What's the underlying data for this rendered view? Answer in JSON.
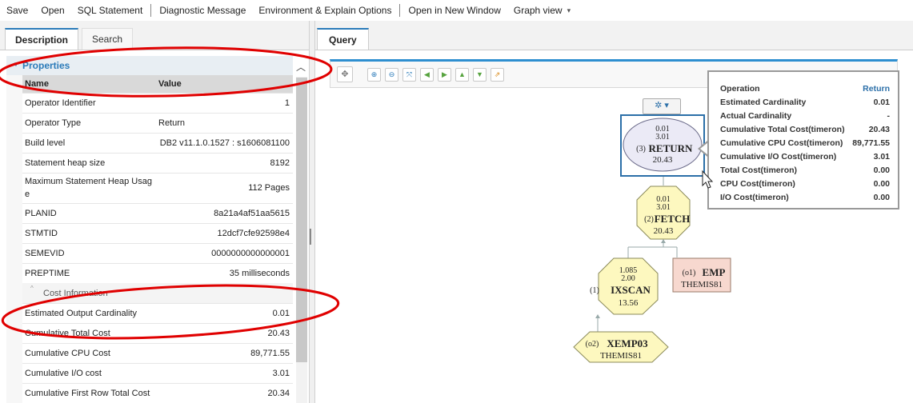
{
  "toolbar": {
    "save": "Save",
    "open": "Open",
    "sql_statement": "SQL Statement",
    "diagnostic": "Diagnostic Message",
    "environment": "Environment & Explain Options",
    "open_window": "Open in New Window",
    "graph_view": "Graph view",
    "graph_view_caret": "▾"
  },
  "left_tabs": {
    "description": "Description",
    "search": "Search"
  },
  "properties": {
    "title": "Properties",
    "header": {
      "name": "Name",
      "value": "Value"
    },
    "rows": [
      {
        "name": "Operator Identifier",
        "value": "1"
      },
      {
        "name": "Operator Type",
        "value": "Return"
      },
      {
        "name": "Build level",
        "value": "DB2 v11.1.0.1527 : s1606081100"
      },
      {
        "name": "Statement heap size",
        "value": "8192"
      },
      {
        "name": "Maximum Statement Heap Usag",
        "name2": "e",
        "value": "112 Pages"
      },
      {
        "name": "PLANID",
        "value": "8a21a4af51aa5615"
      },
      {
        "name": "STMTID",
        "value": "12dcf7cfe92598e4"
      },
      {
        "name": "SEMEVID",
        "value": "0000000000000001"
      },
      {
        "name": "PREPTIME",
        "value": "35 milliseconds"
      }
    ],
    "cost_section": "Cost Information",
    "cost_rows": [
      {
        "name": "Estimated Output Cardinality",
        "value": "0.01"
      },
      {
        "name": "Cumulative Total Cost",
        "value": "20.43"
      },
      {
        "name": "Cumulative CPU Cost",
        "value": "89,771.55"
      },
      {
        "name": "Cumulative I/O cost",
        "value": "3.01"
      },
      {
        "name": "Cumulative First Row Total Cost",
        "value": "20.34"
      }
    ]
  },
  "right_tab": "Query",
  "graph": {
    "return": {
      "card": "0.01",
      "io": "3.01",
      "id": "(3)",
      "label": "RETURN",
      "cost": "20.43"
    },
    "fetch": {
      "card": "0.01",
      "io": "3.01",
      "id": "(2)",
      "label": "FETCH",
      "cost": "20.43"
    },
    "ixscan": {
      "card": "1.085",
      "io": "2.00",
      "id": "(1)",
      "label": "IXSCAN",
      "cost": "13.56"
    },
    "emp": {
      "id": "(o1)",
      "label": "EMP",
      "schema": "THEMIS81"
    },
    "xemp03": {
      "id": "(o2)",
      "label": "XEMP03",
      "schema": "THEMIS81"
    }
  },
  "tooltip": {
    "header": {
      "name": "Operation",
      "value": "Return"
    },
    "rows": [
      {
        "name": "Estimated Cardinality",
        "value": "0.01"
      },
      {
        "name": "Actual Cardinality",
        "value": "-"
      },
      {
        "name": "Cumulative Total Cost(timeron)",
        "value": "20.43"
      },
      {
        "name": "Cumulative CPU Cost(timeron)",
        "value": "89,771.55"
      },
      {
        "name": "Cumulative I/O Cost(timeron)",
        "value": "3.01"
      },
      {
        "name": "Total Cost(timeron)",
        "value": "0.00"
      },
      {
        "name": "CPU Cost(timeron)",
        "value": "0.00"
      },
      {
        "name": "I/O Cost(timeron)",
        "value": "0.00"
      }
    ]
  },
  "colors": {
    "accent": "#2b7bb9",
    "annotation_red": "#e00000",
    "node_yellow": "#fdf8bf",
    "node_pink": "#f7d8cf",
    "return_fill": "#ebeaf6"
  }
}
